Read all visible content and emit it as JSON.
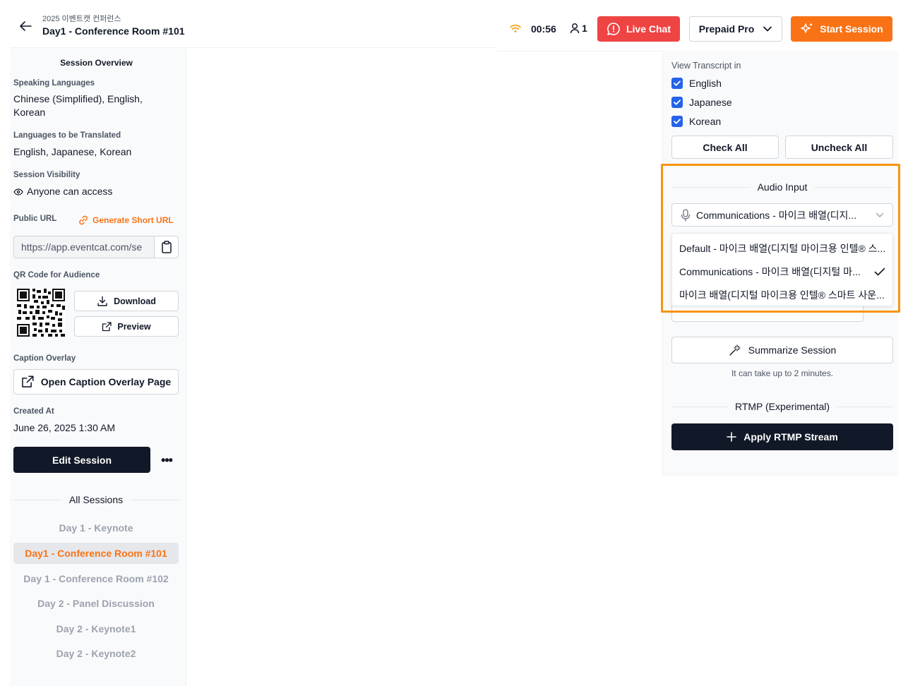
{
  "header": {
    "event_name": "2025 이벤트캣 컨퍼런스",
    "session_title": "Day1 - Conference Room #101",
    "timer": "00:56",
    "participants": "1",
    "live_chat_label": "Live Chat",
    "plan_label": "Prepaid Pro",
    "start_label": "Start Session"
  },
  "left": {
    "overview_title": "Session Overview",
    "speaking_languages_label": "Speaking Languages",
    "speaking_languages_value": "Chinese (Simplified), English, Korean",
    "translated_label": "Languages to be Translated",
    "translated_value": "English, Japanese, Korean",
    "visibility_label": "Session Visibility",
    "visibility_value": "Anyone can access",
    "public_url_label": "Public URL",
    "generate_short_url": "Generate Short URL",
    "public_url_value": "https://app.eventcat.com/se",
    "qr_label": "QR Code for Audience",
    "download_label": "Download",
    "preview_label": "Preview",
    "caption_overlay_label": "Caption Overlay",
    "open_overlay_label": "Open Caption Overlay Page",
    "created_at_label": "Created At",
    "created_at_value": "June 26, 2025 1:30 AM",
    "edit_label": "Edit Session",
    "more_label": "•••",
    "all_sessions_title": "All Sessions",
    "sessions": [
      {
        "label": "Day 1 - Keynote",
        "active": false
      },
      {
        "label": "Day1 - Conference Room #101",
        "active": true
      },
      {
        "label": "Day 1 - Conference Room #102",
        "active": false
      },
      {
        "label": "Day 2 - Panel Discussion",
        "active": false
      },
      {
        "label": "Day 2 - Keynote1",
        "active": false
      },
      {
        "label": "Day 2 - Keynote2",
        "active": false
      }
    ]
  },
  "right": {
    "view_transcript_label": "View Transcript in",
    "languages": [
      {
        "label": "English",
        "checked": true
      },
      {
        "label": "Japanese",
        "checked": true
      },
      {
        "label": "Korean",
        "checked": true
      }
    ],
    "check_all_label": "Check All",
    "uncheck_all_label": "Uncheck All",
    "audio_input_title": "Audio Input",
    "selected_device": "Communications - 마이크 배열(디지...",
    "devices": [
      {
        "label": "Default - 마이크 배열(디지털 마이크용 인텔® 스...",
        "selected": false
      },
      {
        "label": "Communications - 마이크 배열(디지털 마...",
        "selected": true
      },
      {
        "label": "마이크 배열(디지털 마이크용 인텔® 스마트 사운...",
        "selected": false
      }
    ],
    "summarize_label": "Summarize Session",
    "summarize_hint": "It can take up to 2 minutes.",
    "rtmp_title": "RTMP (Experimental)",
    "rtmp_button": "Apply RTMP Stream"
  },
  "colors": {
    "accent": "#f97316",
    "danger": "#ef4444",
    "dark": "#111827",
    "checkbox": "#2563eb",
    "highlight": "#f99311"
  }
}
